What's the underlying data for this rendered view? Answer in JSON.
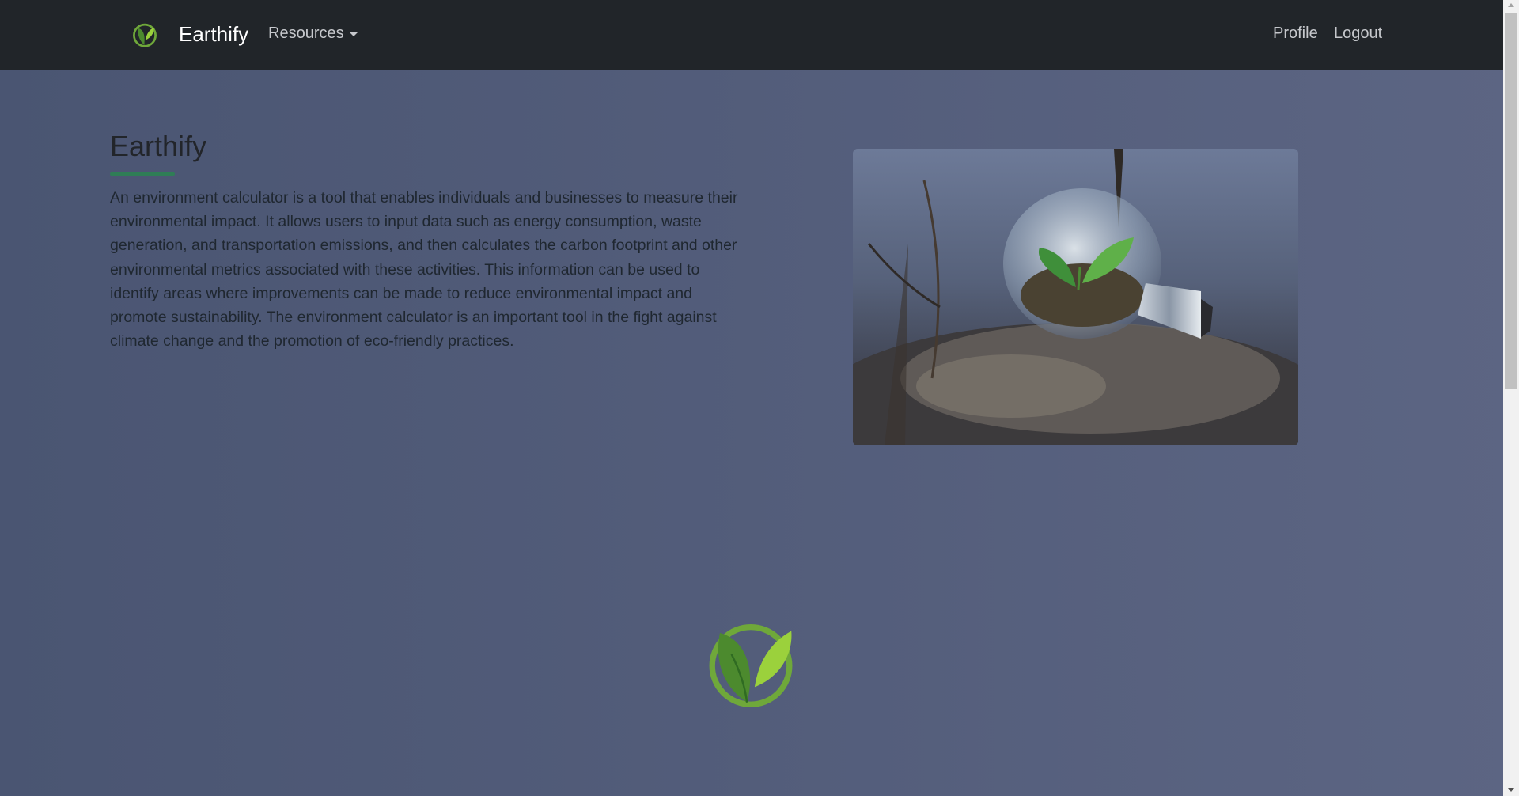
{
  "navbar": {
    "logo_icon": "leaf-circle-icon",
    "brand": "Earthify",
    "resources_label": "Resources",
    "profile_label": "Profile",
    "logout_label": "Logout"
  },
  "main": {
    "title": "Earthify",
    "description": "An environment calculator is a tool that enables individuals and businesses to measure their environmental impact. It allows users to input data such as energy consumption, waste generation, and transportation emissions, and then calculates the carbon footprint and other environmental metrics associated with these activities. This information can be used to identify areas where improvements can be made to reduce environmental impact and promote sustainability. The environment calculator is an important tool in the fight against climate change and the promotion of eco-friendly practices.",
    "image_icon": "lightbulb-plant-photo",
    "footer_logo_icon": "leaf-circle-icon"
  },
  "colors": {
    "navbar_bg": "#212529",
    "accent_green": "#2f7d56",
    "page_bg_start": "#4a5572",
    "page_bg_end": "#5c6583"
  }
}
